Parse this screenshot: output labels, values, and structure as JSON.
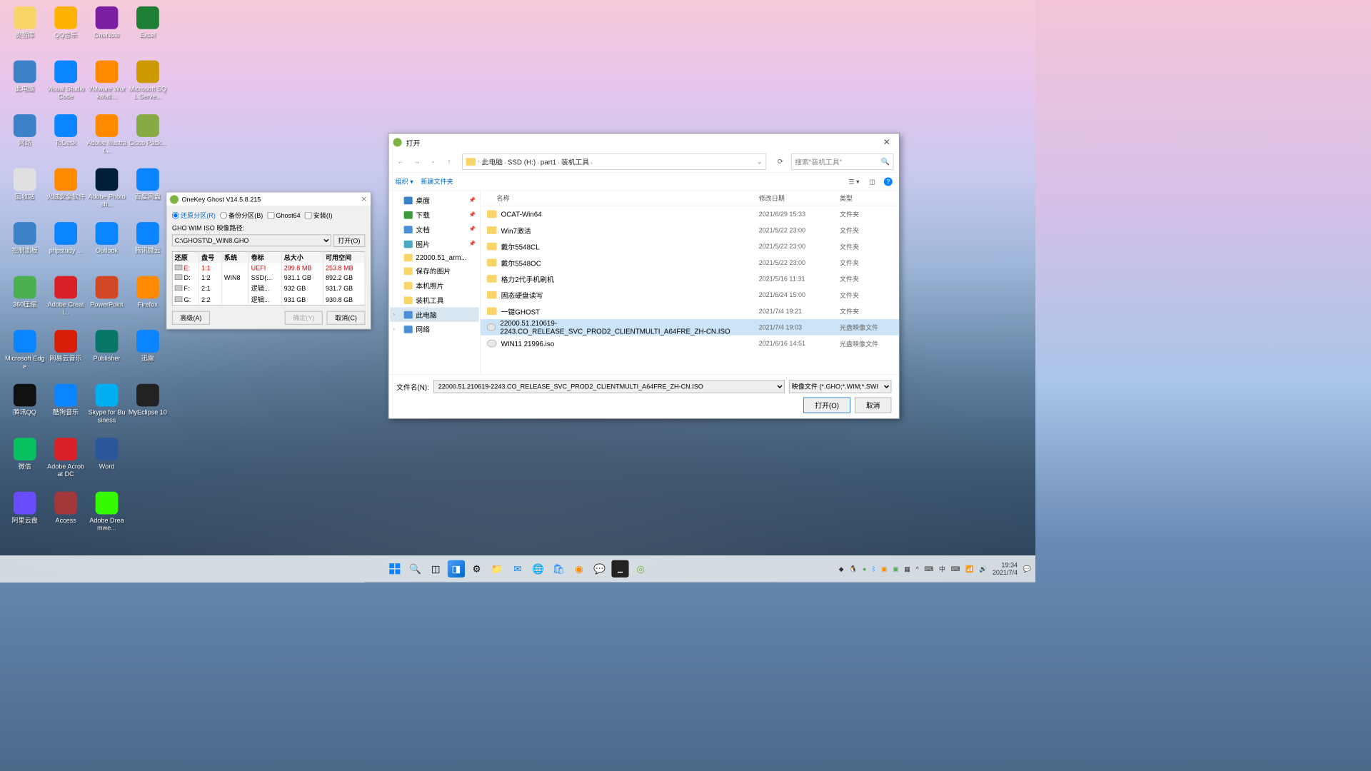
{
  "desktop": [
    {
      "label": "奥哲库",
      "color": "#f8d568"
    },
    {
      "label": "QQ音乐",
      "color": "#ffb300"
    },
    {
      "label": "OneNote",
      "color": "#7b1fa2"
    },
    {
      "label": "Excel",
      "color": "#1e7e34"
    },
    {
      "label": "此电脑",
      "color": "#3b82c8"
    },
    {
      "label": "Visual Studio Code",
      "color": "#0a84ff"
    },
    {
      "label": "VMware Workstati...",
      "color": "#ff8a00"
    },
    {
      "label": "Microsoft SQL Serve...",
      "color": "#cc9900"
    },
    {
      "label": "网路",
      "color": "#3b82c8"
    },
    {
      "label": "ToDesk",
      "color": "#0a84ff"
    },
    {
      "label": "Adobe Illustrat...",
      "color": "#ff8a00"
    },
    {
      "label": "Cisco Pack...",
      "color": "#88aa44"
    },
    {
      "label": "回收站",
      "color": "#e0e0e0"
    },
    {
      "label": "火绒安全软件",
      "color": "#ff8a00"
    },
    {
      "label": "Adobe Photosh...",
      "color": "#001e36"
    },
    {
      "label": "百度网盘",
      "color": "#0a84ff"
    },
    {
      "label": "控制面板",
      "color": "#3b82c8"
    },
    {
      "label": "phpstudy ...",
      "color": "#0a84ff"
    },
    {
      "label": "Outlook",
      "color": "#0a84ff"
    },
    {
      "label": "腾讯微云",
      "color": "#0a84ff"
    },
    {
      "label": "360压缩",
      "color": "#4caf50"
    },
    {
      "label": "Adobe Creati...",
      "color": "#da1f26"
    },
    {
      "label": "PowerPoint",
      "color": "#d24726"
    },
    {
      "label": "Firefox",
      "color": "#ff8a00"
    },
    {
      "label": "Microsoft Edge",
      "color": "#0a84ff"
    },
    {
      "label": "网易云音乐",
      "color": "#d81e06"
    },
    {
      "label": "Publisher",
      "color": "#077568"
    },
    {
      "label": "迅雷",
      "color": "#0a84ff"
    },
    {
      "label": "腾讯QQ",
      "color": "#111"
    },
    {
      "label": "酷狗音乐",
      "color": "#0a84ff"
    },
    {
      "label": "Skype for Business",
      "color": "#00aff0"
    },
    {
      "label": "MyEclipse 10",
      "color": "#222"
    },
    {
      "label": "微信",
      "color": "#07c160"
    },
    {
      "label": "Adobe Acrobat DC",
      "color": "#da1f26"
    },
    {
      "label": "Word",
      "color": "#2b579a"
    },
    {
      "label": "",
      "color": "transparent"
    },
    {
      "label": "阿里云盘",
      "color": "#6a4cff"
    },
    {
      "label": "Access",
      "color": "#a4373a"
    },
    {
      "label": "Adobe Dreamwe...",
      "color": "#35fa00"
    }
  ],
  "ghost": {
    "title": "OneKey Ghost V14.5.8.215",
    "opt_restore": "还原分区(R)",
    "opt_backup": "备份分区(B)",
    "chk_ghost64": "Ghost64",
    "chk_install": "安装(I)",
    "path_label": "GHO WIM ISO 映像路径:",
    "path_value": "C:\\GHOST\\D_WIN8.GHO",
    "open_btn": "打开(O)",
    "cols": [
      "还原",
      "盘号",
      "系统",
      "卷标",
      "总大小",
      "可用空间"
    ],
    "rows": [
      {
        "drive": "E:",
        "num": "1:1",
        "sys": "",
        "label": "UEFI",
        "total": "299.8 MB",
        "free": "253.8 MB",
        "red": true
      },
      {
        "drive": "D:",
        "num": "1:2",
        "sys": "WIN8",
        "label": "SSD(...",
        "total": "931.1 GB",
        "free": "892.2 GB"
      },
      {
        "drive": "F:",
        "num": "2:1",
        "sys": "",
        "label": "逻辑...",
        "total": "932 GB",
        "free": "931.7 GB"
      },
      {
        "drive": "G:",
        "num": "2:2",
        "sys": "",
        "label": "逻辑...",
        "total": "931 GB",
        "free": "930.8 GB"
      }
    ],
    "btn_adv": "高级(A)",
    "btn_ok": "确定(Y)",
    "btn_cancel": "取消(C)"
  },
  "dialog": {
    "title": "打开",
    "breadcrumbs": [
      "此电脑",
      "SSD (H:)",
      "part1",
      "装机工具"
    ],
    "search_placeholder": "搜索\"装机工具\"",
    "toolbar_org": "组织 ▾",
    "toolbar_new": "新建文件夹",
    "nav": [
      {
        "label": "桌面",
        "cls": "desktop",
        "pin": true
      },
      {
        "label": "下载",
        "cls": "download",
        "pin": true
      },
      {
        "label": "文档",
        "cls": "doc",
        "pin": true
      },
      {
        "label": "图片",
        "cls": "pic",
        "pin": true
      },
      {
        "label": "22000.51_arm...",
        "cls": "folder"
      },
      {
        "label": "保存的图片",
        "cls": "folder"
      },
      {
        "label": "本机照片",
        "cls": "folder"
      },
      {
        "label": "装机工具",
        "cls": "folder"
      },
      {
        "label": "此电脑",
        "cls": "pc",
        "sel": true,
        "exp": true
      },
      {
        "label": "网络",
        "cls": "net",
        "exp": true
      }
    ],
    "headers": {
      "name": "名称",
      "date": "修改日期",
      "type": "类型"
    },
    "files": [
      {
        "name": "OCAT-Win64",
        "date": "2021/6/29 15:33",
        "type": "文件夹",
        "ico": "folder"
      },
      {
        "name": "Win7激活",
        "date": "2021/5/22 23:00",
        "type": "文件夹",
        "ico": "folder"
      },
      {
        "name": "戴尔5548CL",
        "date": "2021/5/22 23:00",
        "type": "文件夹",
        "ico": "folder"
      },
      {
        "name": "戴尔5548OC",
        "date": "2021/5/22 23:00",
        "type": "文件夹",
        "ico": "folder"
      },
      {
        "name": "格力2代手机刷机",
        "date": "2021/5/16 11:31",
        "type": "文件夹",
        "ico": "folder"
      },
      {
        "name": "固态硬盘读写",
        "date": "2021/6/24 15:00",
        "type": "文件夹",
        "ico": "folder"
      },
      {
        "name": "一键GHOST",
        "date": "2021/7/4 19:21",
        "type": "文件夹",
        "ico": "folder"
      },
      {
        "name": "22000.51.210619-2243.CO_RELEASE_SVC_PROD2_CLIENTMULTI_A64FRE_ZH-CN.ISO",
        "date": "2021/7/4 19:03",
        "type": "光盘映像文件",
        "ico": "iso",
        "sel": true
      },
      {
        "name": "WIN11 21996.iso",
        "date": "2021/6/16 14:51",
        "type": "光盘映像文件",
        "ico": "iso"
      }
    ],
    "filename_label": "文件名(N):",
    "filename_value": "22000.51.210619-2243.CO_RELEASE_SVC_PROD2_CLIENTMULTI_A64FRE_ZH-CN.ISO",
    "filetype": "映像文件 (*.GHO;*.WIM;*.SWI",
    "btn_open": "打开(O)",
    "btn_cancel": "取消"
  },
  "taskbar": {
    "time": "19:34",
    "date": "2021/7/4"
  }
}
